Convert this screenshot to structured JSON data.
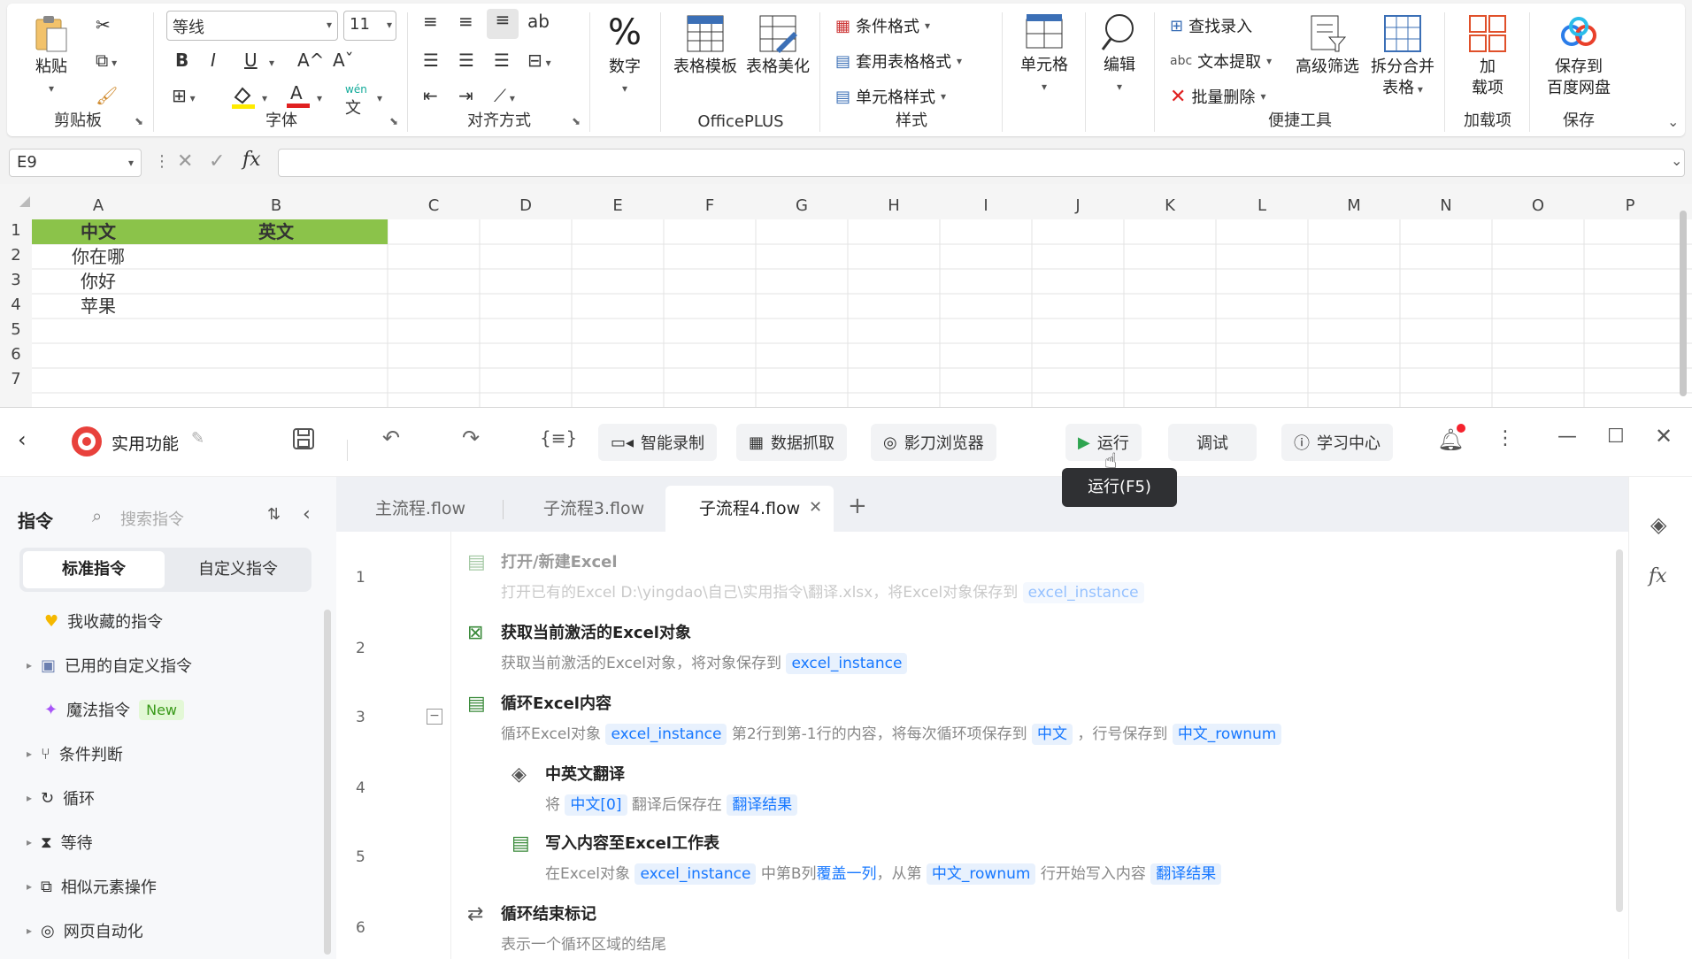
{
  "ribbon": {
    "clipboard": {
      "paste": "粘贴",
      "label": "剪贴板"
    },
    "font": {
      "name": "等线",
      "size": "11",
      "label": "字体",
      "bold": "B",
      "italic": "I",
      "underline": "U",
      "grow": "A^",
      "shrink": "Aˇ",
      "pinyin": "wén"
    },
    "align": {
      "label": "对齐方式"
    },
    "number": {
      "label": "数字"
    },
    "officeplus": {
      "template": "表格模板",
      "beautify": "表格美化",
      "label": "OfficePLUS"
    },
    "styles": {
      "cond": "条件格式",
      "table": "套用表格格式",
      "cell": "单元格样式",
      "label": "样式"
    },
    "cells": {
      "label": "单元格"
    },
    "edit": {
      "label": "编辑"
    },
    "tools": {
      "find": "查找录入",
      "extract": "文本提取",
      "delete": "批量删除",
      "filter": "高级筛选",
      "split1": "拆分合并",
      "split2": "表格",
      "label": "便捷工具"
    },
    "addins": {
      "l1": "加",
      "l2": "载项",
      "label": "加载项"
    },
    "save": {
      "l1": "保存到",
      "l2": "百度网盘",
      "label": "保存"
    }
  },
  "formula_bar": {
    "cell_ref": "E9",
    "fx": "fx"
  },
  "sheet": {
    "columns": [
      "A",
      "B",
      "C",
      "D",
      "E",
      "F",
      "G",
      "H",
      "I",
      "J",
      "K",
      "L",
      "M",
      "N",
      "O",
      "P"
    ],
    "rows": [
      "1",
      "2",
      "3",
      "4",
      "5",
      "6",
      "7"
    ],
    "header": {
      "a1": "中文",
      "b1": "英文"
    },
    "values": [
      "你在哪",
      "你好",
      "苹果"
    ],
    "header_color": "#8bc34a"
  },
  "app": {
    "project": "实用功能",
    "toolbar": {
      "record": "智能录制",
      "scrape": "数据抓取",
      "browser": "影刀浏览器",
      "run": "运行",
      "run_tip": "运行(F5)",
      "debug": "调试",
      "learn": "学习中心"
    },
    "sidebar": {
      "title": "指令",
      "search": "搜索指令",
      "tab_std": "标准指令",
      "tab_custom": "自定义指令",
      "items": [
        "我收藏的指令",
        "已用的自定义指令",
        "魔法指令",
        "条件判断",
        "循环",
        "等待",
        "相似元素操作",
        "网页自动化"
      ],
      "new_badge": "New"
    },
    "tabs": [
      "主流程.flow",
      "子流程3.flow",
      "子流程4.flow"
    ],
    "steps": [
      {
        "n": "1",
        "title": "打开/新建Excel",
        "desc": "打开已有的Excel D:\\yingdao\\自己\\实用指令\\翻译.xlsx，将Excel对象保存到",
        "var": "excel_instance"
      },
      {
        "n": "2",
        "title": "获取当前激活的Excel对象",
        "desc": "获取当前激活的Excel对象，将对象保存到",
        "var": "excel_instance"
      },
      {
        "n": "3",
        "title": "循环Excel内容",
        "d1": "循环Excel对象",
        "v1": "excel_instance",
        "d2": "第2行到第-1行的内容，将每次循环项保存到",
        "v2": "中文",
        "d3": "，行号保存到",
        "v3": "中文_rownum"
      },
      {
        "n": "4",
        "title": "中英文翻译",
        "d1": "将",
        "v1": "中文[0]",
        "d2": "翻译后保存在",
        "v2": "翻译结果"
      },
      {
        "n": "5",
        "title": "写入内容至Excel工作表",
        "d1": "在Excel对象",
        "v1": "excel_instance",
        "d2": "中第B列",
        "v2": "覆盖一列",
        "d3": "，从第",
        "v3": "中文_rownum",
        "d4": "行开始写入内容",
        "v4": "翻译结果"
      },
      {
        "n": "6",
        "title": "循环结束标记",
        "desc": "表示一个循环区域的结尾"
      }
    ]
  }
}
